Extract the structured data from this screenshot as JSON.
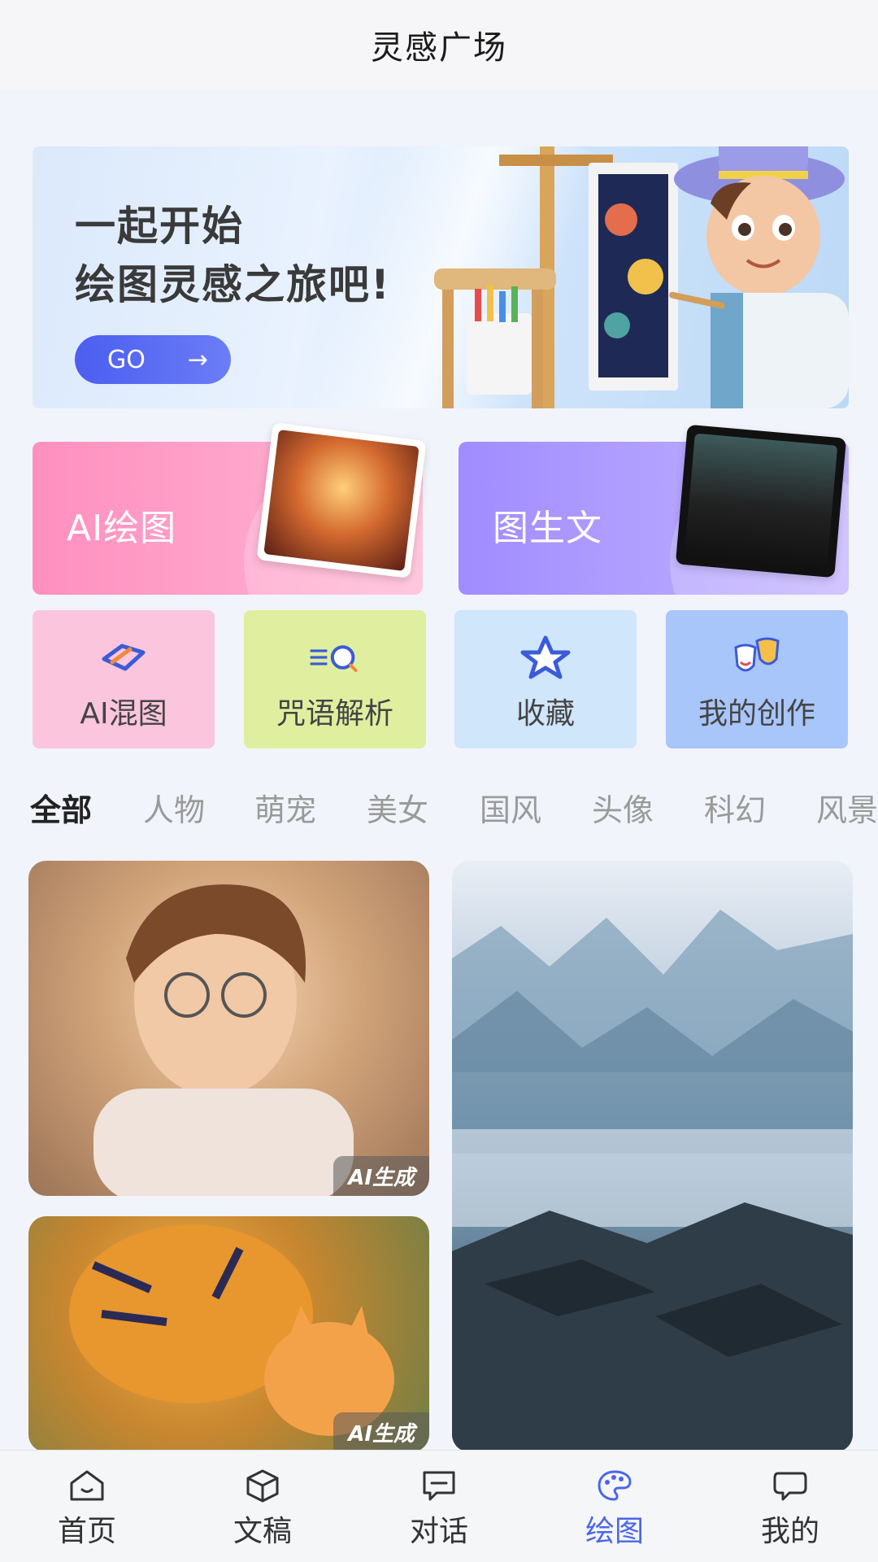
{
  "header": {
    "title": "灵感广场"
  },
  "banner": {
    "line1": "一起开始",
    "line2": "绘图灵感之旅吧!",
    "go_label": "GO",
    "go_arrow": "→"
  },
  "features": [
    {
      "label": "AI绘图"
    },
    {
      "label": "图生文"
    }
  ],
  "tiles": [
    {
      "label": "AI混图",
      "icon": "mix-images-icon"
    },
    {
      "label": "咒语解析",
      "icon": "prompt-search-icon"
    },
    {
      "label": "收藏",
      "icon": "star-icon"
    },
    {
      "label": "我的创作",
      "icon": "masks-icon"
    }
  ],
  "categories": [
    "全部",
    "人物",
    "萌宠",
    "美女",
    "国风",
    "头像",
    "科幻",
    "风景"
  ],
  "active_category": "全部",
  "gallery": [
    {
      "badge": "AI生成",
      "subject": "boy with glasses portrait"
    },
    {
      "badge": "AI生成",
      "subject": "tiger and kitten"
    },
    {
      "subject": "misty mountain village"
    }
  ],
  "nav": [
    {
      "label": "首页",
      "icon": "home-icon"
    },
    {
      "label": "文稿",
      "icon": "cube-icon"
    },
    {
      "label": "对话",
      "icon": "chat-icon"
    },
    {
      "label": "绘图",
      "icon": "palette-icon",
      "active": true
    },
    {
      "label": "我的",
      "icon": "profile-icon"
    }
  ],
  "colors": {
    "accent": "#4a67e8",
    "go_button": "#4b5ef0",
    "ai_draw_card": "#ff8fbf",
    "img2text_card": "#a08cff"
  }
}
